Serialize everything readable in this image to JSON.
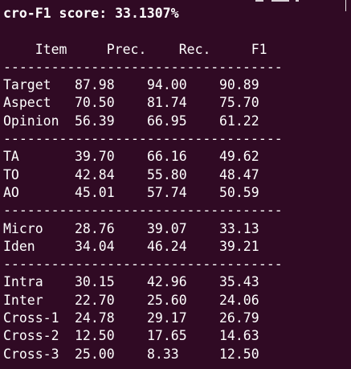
{
  "window": {
    "colors": {
      "background": "#300a24",
      "foreground": "#ffffff"
    }
  },
  "terminal": {
    "header_line": "cro-F1 score: 33.1307%",
    "columns": [
      "Item",
      "Prec.",
      "Rec.",
      "F1"
    ],
    "separator": "-----------------------------------",
    "groups": [
      {
        "rows": [
          {
            "item": "Target",
            "prec": "87.98",
            "rec": "94.00",
            "f1": "90.89"
          },
          {
            "item": "Aspect",
            "prec": "70.50",
            "rec": "81.74",
            "f1": "75.70"
          },
          {
            "item": "Opinion",
            "prec": "56.39",
            "rec": "66.95",
            "f1": "61.22"
          }
        ]
      },
      {
        "rows": [
          {
            "item": "TA",
            "prec": "39.70",
            "rec": "66.16",
            "f1": "49.62"
          },
          {
            "item": "TO",
            "prec": "42.84",
            "rec": "55.80",
            "f1": "48.47"
          },
          {
            "item": "AO",
            "prec": "45.01",
            "rec": "57.74",
            "f1": "50.59"
          }
        ]
      },
      {
        "rows": [
          {
            "item": "Micro",
            "prec": "28.76",
            "rec": "39.07",
            "f1": "33.13"
          },
          {
            "item": "Iden",
            "prec": "34.04",
            "rec": "46.24",
            "f1": "39.21"
          }
        ]
      },
      {
        "rows": [
          {
            "item": "Intra",
            "prec": "30.15",
            "rec": "42.96",
            "f1": "35.43"
          },
          {
            "item": "Inter",
            "prec": "22.70",
            "rec": "25.60",
            "f1": "24.06"
          },
          {
            "item": "Cross-1",
            "prec": "24.78",
            "rec": "29.17",
            "f1": "26.79"
          },
          {
            "item": "Cross-2",
            "prec": "12.50",
            "rec": "17.65",
            "f1": "14.63"
          },
          {
            "item": "Cross-3",
            "prec": "25.00",
            "rec": "8.33",
            "f1": "12.50"
          }
        ]
      }
    ]
  }
}
